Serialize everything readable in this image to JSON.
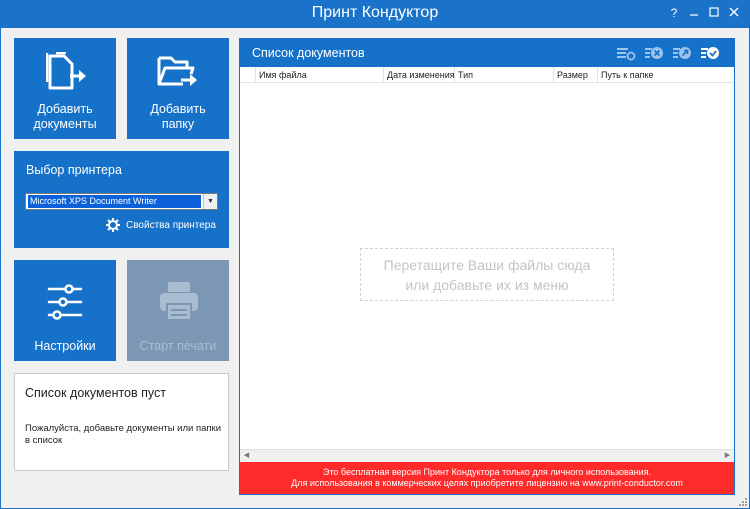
{
  "window": {
    "title": "Принт Кондуктор",
    "help": "?"
  },
  "tiles": {
    "add_documents": "Добавить документы",
    "add_folder": "Добавить папку",
    "settings": "Настройки",
    "start_print": "Старт печати"
  },
  "printer": {
    "title": "Выбор принтера",
    "selected": "Microsoft XPS Document Writer",
    "properties": "Свойства принтера"
  },
  "status": {
    "title": "Список документов пуст",
    "message": "Пожалуйста, добавьте документы или папки в список"
  },
  "documents": {
    "title": "Список документов",
    "columns": [
      "Имя файла",
      "Дата изменения",
      "Тип",
      "Размер",
      "Путь к папке"
    ],
    "drop_hint_line1": "Перетащите Ваши файлы сюда",
    "drop_hint_line2": "или добавьте их из меню"
  },
  "banner": {
    "line1": "Это бесплатная версия Принт Кондуктора только для личного использования.",
    "line2": "Для использования в коммерческих целях приобретите лицензию на www.print-conductor.com"
  },
  "colors": {
    "accent": "#1671c9",
    "titlebar": "#1a73c8",
    "banner": "#ff2a2a",
    "disabled_tile": "#7b97b3"
  }
}
